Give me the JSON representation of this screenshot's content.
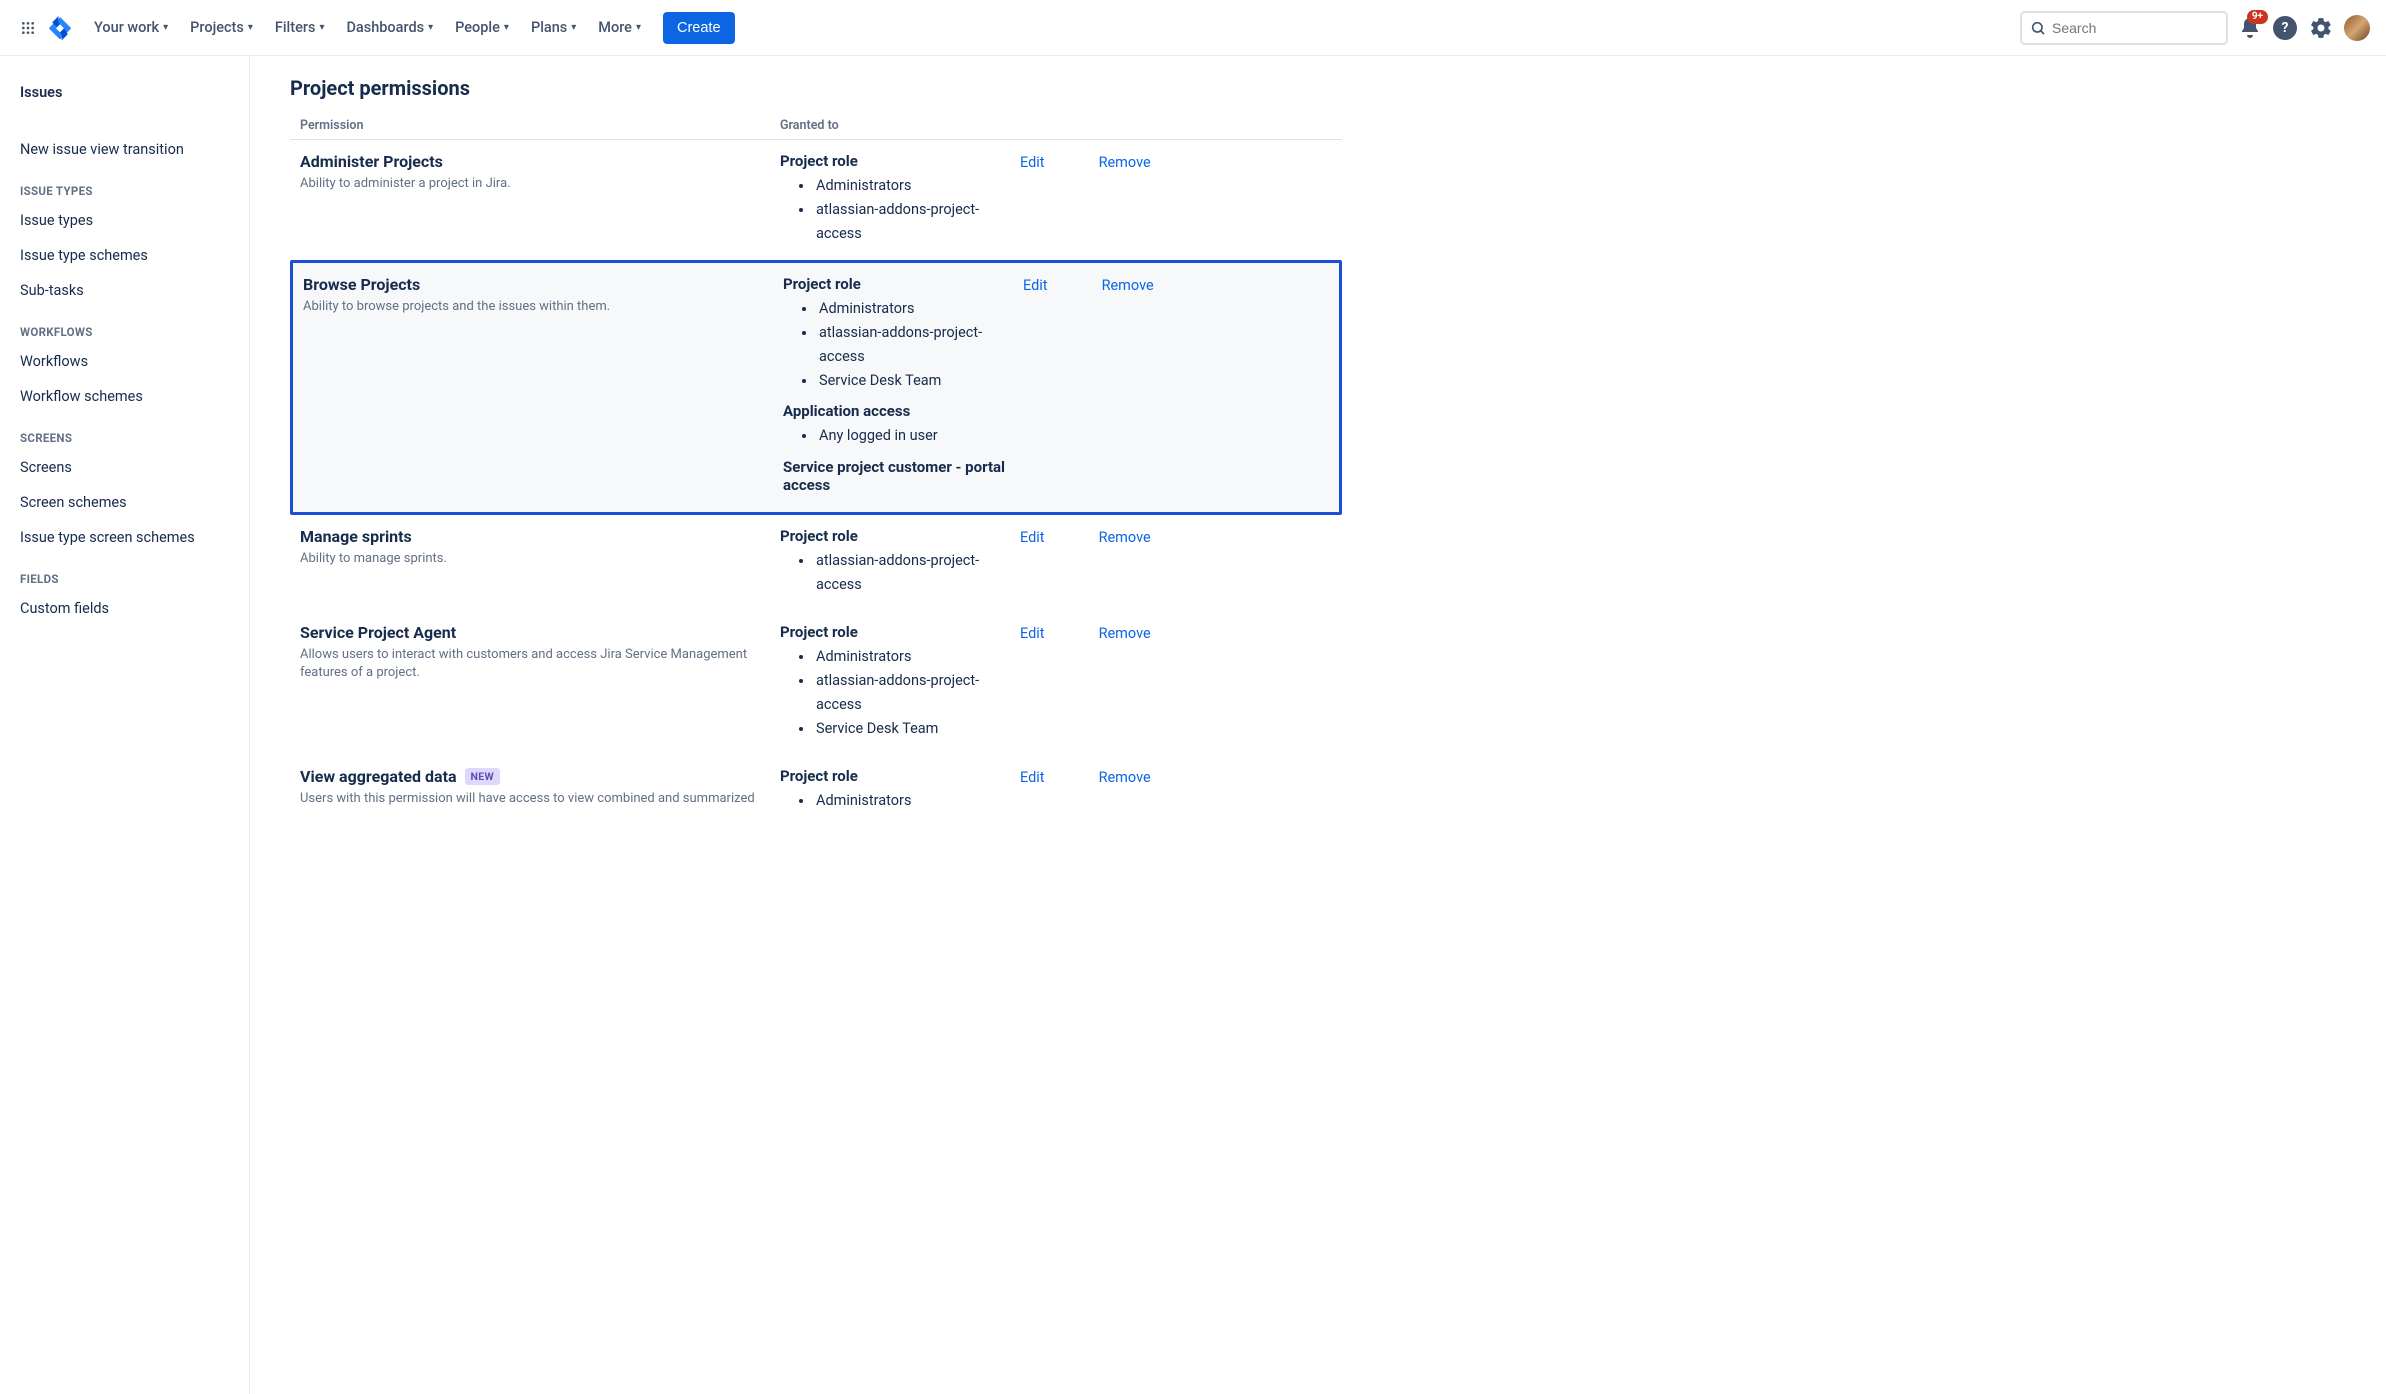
{
  "topnav": {
    "items": [
      "Your work",
      "Projects",
      "Filters",
      "Dashboards",
      "People",
      "Plans",
      "More"
    ],
    "create_label": "Create",
    "search_placeholder": "Search",
    "notif_badge": "9+"
  },
  "sidebar": {
    "top_item": "Issues",
    "loose_item": "New issue view transition",
    "groups": [
      {
        "header": "ISSUE TYPES",
        "items": [
          "Issue types",
          "Issue type schemes",
          "Sub-tasks"
        ]
      },
      {
        "header": "WORKFLOWS",
        "items": [
          "Workflows",
          "Workflow schemes"
        ]
      },
      {
        "header": "SCREENS",
        "items": [
          "Screens",
          "Screen schemes",
          "Issue type screen schemes"
        ]
      },
      {
        "header": "FIELDS",
        "items": [
          "Custom fields"
        ]
      }
    ]
  },
  "page": {
    "heading": "Project permissions",
    "col_permission": "Permission",
    "col_granted": "Granted to",
    "edit_label": "Edit",
    "remove_label": "Remove",
    "new_label": "NEW",
    "permissions": [
      {
        "name": "Administer Projects",
        "desc": "Ability to administer a project in Jira.",
        "grants": [
          {
            "header": "Project role",
            "items": [
              "Administrators",
              "atlassian-addons-project-access"
            ]
          }
        ],
        "highlighted": false,
        "new": false
      },
      {
        "name": "Browse Projects",
        "desc": "Ability to browse projects and the issues within them.",
        "grants": [
          {
            "header": "Project role",
            "items": [
              "Administrators",
              "atlassian-addons-project-access",
              "Service Desk Team"
            ]
          },
          {
            "header": "Application access",
            "items": [
              "Any logged in user"
            ]
          },
          {
            "header": "Service project customer - portal access",
            "items": []
          }
        ],
        "highlighted": true,
        "new": false
      },
      {
        "name": "Manage sprints",
        "desc": "Ability to manage sprints.",
        "grants": [
          {
            "header": "Project role",
            "items": [
              "atlassian-addons-project-access"
            ]
          }
        ],
        "highlighted": false,
        "new": false
      },
      {
        "name": "Service Project Agent",
        "desc": "Allows users to interact with customers and access Jira Service Management features of a project.",
        "grants": [
          {
            "header": "Project role",
            "items": [
              "Administrators",
              "atlassian-addons-project-access",
              "Service Desk Team"
            ]
          }
        ],
        "highlighted": false,
        "new": false
      },
      {
        "name": "View aggregated data",
        "desc": "Users with this permission will have access to view combined and summarized",
        "grants": [
          {
            "header": "Project role",
            "items": [
              "Administrators"
            ]
          }
        ],
        "highlighted": false,
        "new": true
      }
    ]
  }
}
